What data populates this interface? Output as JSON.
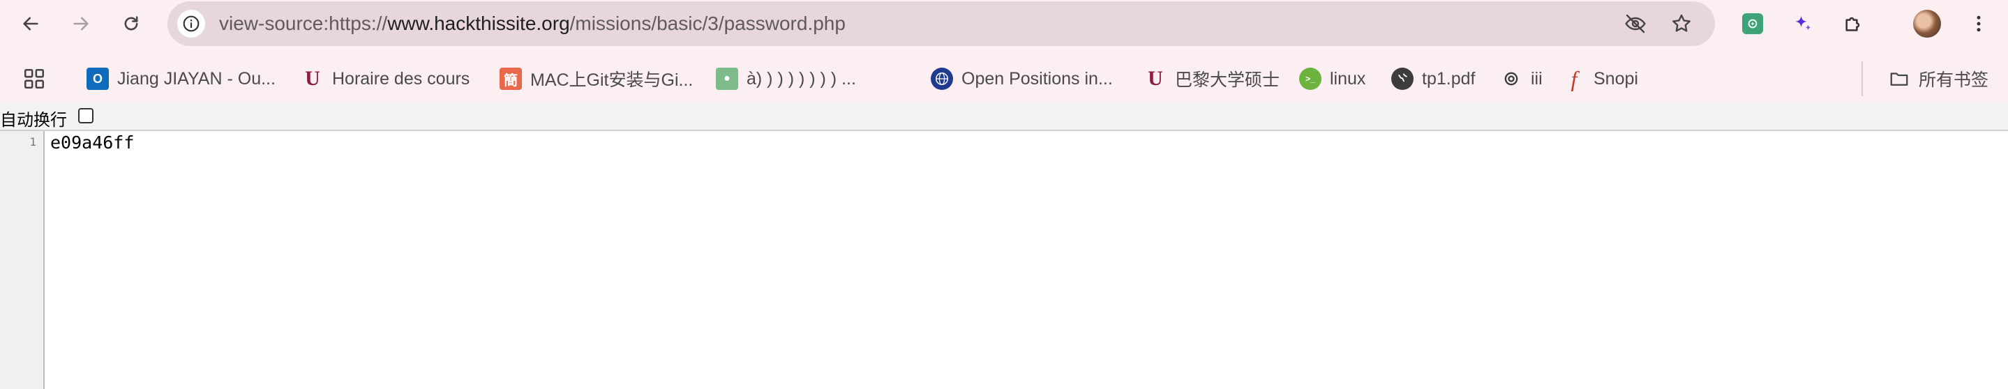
{
  "browser": {
    "url_prefix": "view-source:https://",
    "url_host": "www.hackthissite.org",
    "url_path": "/missions/basic/3/password.php",
    "bookmarks": [
      {
        "label": "Jiang JIAYAN - Ou...",
        "icon": "outlook-icon",
        "color": "#0f6cbd"
      },
      {
        "label": "Horaire des cours",
        "icon": "university-logo-icon",
        "color": "#8b1e3f"
      },
      {
        "label": "MAC上Git安装与Gi...",
        "icon": "jianshu-icon",
        "color": "#e9684b"
      },
      {
        "label": "à) ) ) ) ) ) ) ) ...",
        "icon": "paw-icon",
        "color": "#7dbb8a"
      },
      {
        "label": "Open Positions in...",
        "icon": "globe-seal-icon",
        "color": "#1f3b8f"
      },
      {
        "label": "巴黎大学硕士",
        "icon": "university-logo-icon",
        "color": "#8b1e3f"
      },
      {
        "label": "linux",
        "icon": "linux-icon",
        "color": "#6cb33e"
      },
      {
        "label": "tp1.pdf",
        "icon": "globe-icon",
        "color": "#3c3c3c"
      },
      {
        "label": "iii",
        "icon": "openai-icon",
        "color": "#3c3c3c"
      },
      {
        "label": "Snopi",
        "icon": "script-f-icon",
        "color": "#c0392b"
      }
    ],
    "all_bookmarks_label": "所有书签"
  },
  "viewer": {
    "wrap_label": "自动换行",
    "wrap_checked": false,
    "lines": [
      {
        "number": "1",
        "text": "e09a46ff"
      }
    ]
  }
}
